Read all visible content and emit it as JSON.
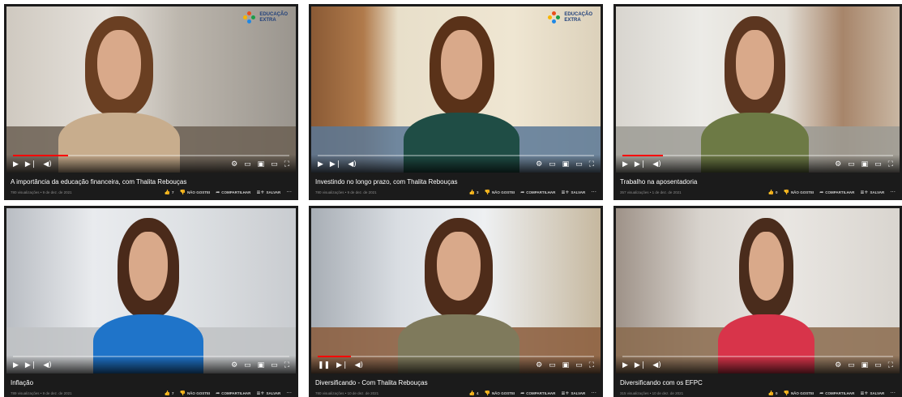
{
  "brand": {
    "logo_text_top": "EDUCAÇÃO",
    "logo_text_bottom": "EXTRA",
    "colors": [
      "#e94e1b",
      "#f7b500",
      "#1a9c47",
      "#1e88e5"
    ]
  },
  "labels": {
    "dislike": "NÃO GOSTEI",
    "share": "COMPARTILHAR",
    "save": "SALVAR",
    "more": "···"
  },
  "icons": {
    "play": "▶",
    "pause": "❚❚",
    "next": "▶❘",
    "volume": "◀)",
    "settings": "⚙",
    "subtitles": "▭",
    "miniplayer": "▣",
    "theater": "▭",
    "fullscreen": "⛶",
    "like": "👍",
    "dislike": "👎",
    "share": "➦",
    "save": "≡+"
  },
  "progress_color": "#ff0000",
  "videos": [
    {
      "title": "A importância da educação financeira, com Thalita Rebouças",
      "views": "780 visualizações • 9 de dez. de 2021",
      "likes": "7",
      "progress": 0.2,
      "playing": false,
      "has_logo": true
    },
    {
      "title": "Investindo no longo prazo, com Thalita Rebouças",
      "views": "780 visualizações • 9 de dez. de 2021",
      "likes": "3",
      "progress": 0,
      "playing": false,
      "has_logo": true
    },
    {
      "title": "Trabalho na aposentadoria",
      "views": "357 visualizações • 1 de dez. de 2021",
      "likes": "0",
      "progress": 0.15,
      "playing": false,
      "has_logo": false
    },
    {
      "title": "Inflação",
      "views": "789 visualizações • 9 de dez. de 2021",
      "likes": "7",
      "progress": 0,
      "playing": false,
      "has_logo": false
    },
    {
      "title": "Diversificando - Com Thalita Rebouças",
      "views": "780 visualizações • 10 de dez. de 2021",
      "likes": "4",
      "progress": 0.12,
      "playing": true,
      "has_logo": false
    },
    {
      "title": "Diversificando com os EFPC",
      "views": "315 visualizações • 10 de dez. de 2021",
      "likes": "0",
      "progress": 0,
      "playing": false,
      "has_logo": false
    }
  ]
}
